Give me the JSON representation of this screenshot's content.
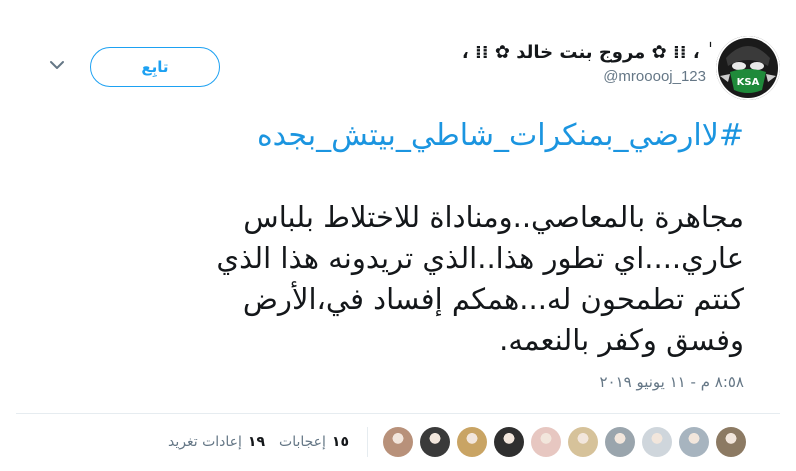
{
  "user": {
    "display_name": "ٰ ، ⁞⁞ ✿ مروج بنت خالد ✿ ⁞⁞ ،",
    "username": "@mrooooj_123",
    "avatar_text": "KSA"
  },
  "follow_label": "تابِع",
  "hashtag": "#لاارضي_بمنكرات_شاطي_بيتش_بجده",
  "tweet_lines": [
    "مجاهرة بالمعاصي..ومناداة للاختلاط بلباس",
    "عاري....اي تطور هذا..الذي تريدونه هذا الذي",
    "كنتم تطمحون له...همكم إفساد في،الأرض",
    "وفسق وكفر بالنعمه."
  ],
  "timestamp": "٨:٥٨ م - ١١ يونيو ٢٠١٩",
  "stats": {
    "retweets_count": "١٩",
    "retweets_label": "إعادات تغريد",
    "likes_count": "١٥",
    "likes_label": "إعجابات"
  },
  "likers": [
    {
      "name": "liker-avatar-1",
      "color": "#b8917a"
    },
    {
      "name": "liker-avatar-2",
      "color": "#3a3a3a"
    },
    {
      "name": "liker-avatar-3",
      "color": "#c9a464"
    },
    {
      "name": "liker-avatar-4",
      "color": "#2f2f2f"
    },
    {
      "name": "liker-avatar-5",
      "color": "#e7c7c1"
    },
    {
      "name": "liker-avatar-6",
      "color": "#d6c29a"
    },
    {
      "name": "liker-avatar-7",
      "color": "#9aa5ad"
    },
    {
      "name": "liker-avatar-8",
      "color": "#cfd6dc"
    },
    {
      "name": "liker-avatar-9",
      "color": "#a7b4bf"
    },
    {
      "name": "liker-avatar-10",
      "color": "#8c7a63"
    }
  ],
  "colors": {
    "accent": "#1da1f2",
    "link": "#1b95e0",
    "text": "#14171a",
    "muted": "#657786"
  }
}
